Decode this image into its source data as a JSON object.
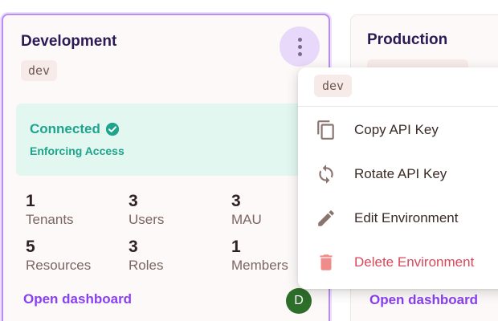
{
  "environments": [
    {
      "title": "Development",
      "key": "dev",
      "status": "Connected",
      "status_detail": "Enforcing Access",
      "stats": [
        {
          "value": "1",
          "label": "Tenants"
        },
        {
          "value": "3",
          "label": "Users"
        },
        {
          "value": "3",
          "label": "MAU"
        },
        {
          "value": "5",
          "label": "Resources"
        },
        {
          "value": "3",
          "label": "Roles"
        },
        {
          "value": "1",
          "label": "Members"
        }
      ],
      "open_link": "Open dashboard",
      "avatar_initial": "D"
    },
    {
      "title": "Production",
      "open_link": "Open dashboard"
    }
  ],
  "menu": {
    "env_key": "dev",
    "items": [
      {
        "label": "Copy API Key",
        "icon": "copy-icon"
      },
      {
        "label": "Rotate API Key",
        "icon": "rotate-icon"
      },
      {
        "label": "Edit Environment",
        "icon": "pencil-icon"
      },
      {
        "label": "Delete Environment",
        "icon": "trash-icon"
      }
    ]
  },
  "colors": {
    "accent": "#8a3ff0",
    "success": "#1ea38c",
    "danger": "#d9475a",
    "avatar": "#2d6e2a"
  }
}
